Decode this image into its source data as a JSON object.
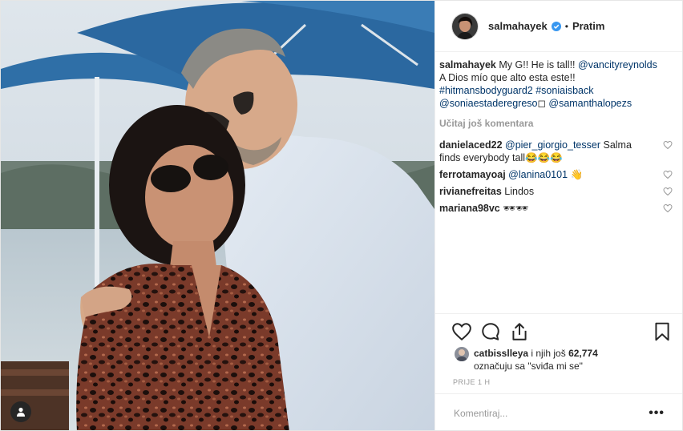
{
  "post": {
    "username": "salmahayek",
    "separator": "•",
    "follow_label": "Pratim",
    "caption": {
      "username": "salmahayek",
      "text_1": " My G!! He is tall!! ",
      "mention_1": "@vancityreynolds",
      "text_2": " A Dios mío que alto esta este!! ",
      "hashtag_1": "#hitmansbodyguard2",
      "hashtag_2": "#soniaisback",
      "mention_2": "@soniaestaderegreso",
      "text_3": "◻",
      "mention_3": "@samanthalopezs"
    },
    "load_more": "Učitaj još komentara",
    "comments": [
      {
        "username": "danielaced22",
        "mention": "@pier_giorgio_tesser",
        "text": " Salma finds everybody tall😂😂😂"
      },
      {
        "username": "ferrotamayoaj",
        "mention": "@lanina0101",
        "text": " 👋"
      },
      {
        "username": "rivianefreitas",
        "mention": "",
        "text": " Lindos"
      },
      {
        "username": "mariana98vc",
        "mention": "",
        "text": " 🕶🕶"
      }
    ],
    "likes": {
      "user": "catbisslleya",
      "middle": " i njih još ",
      "count": "62,774",
      "line2": "označuju sa \"sviđa mi se\""
    },
    "time": "PRIJE 1 H",
    "comment_placeholder": "Komentiraj...",
    "more_label": "•••"
  },
  "icons": {
    "like": "heart-icon",
    "comment": "comment-icon",
    "share": "share-icon",
    "save": "bookmark-icon",
    "verified": "verified-badge-icon",
    "tag": "person-tag-icon"
  },
  "colors": {
    "link": "#003569",
    "verified": "#3897f0",
    "muted": "#999999"
  }
}
